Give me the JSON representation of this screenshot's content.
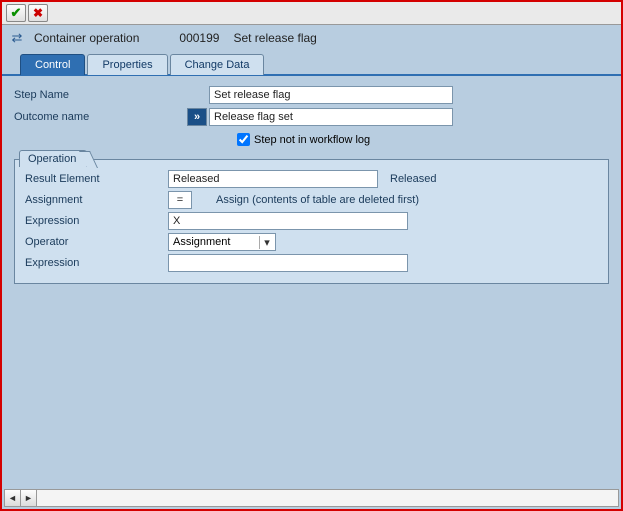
{
  "title": {
    "object": "Container operation",
    "number": "000199",
    "desc": "Set release flag"
  },
  "tabs": [
    {
      "label": "Control",
      "active": true
    },
    {
      "label": "Properties",
      "active": false
    },
    {
      "label": "Change Data",
      "active": false
    }
  ],
  "control": {
    "step_name_label": "Step Name",
    "step_name_value": "Set release flag",
    "outcome_name_label": "Outcome name",
    "outcome_name_value": "Release flag set",
    "not_in_log_label": "Step not in workflow log",
    "not_in_log_checked": true
  },
  "operation": {
    "legend": "Operation",
    "result_label": "Result Element",
    "result_value": "Released",
    "result_after": "Released",
    "assignment_label": "Assignment",
    "assignment_value": "=",
    "assignment_desc": "Assign (contents of table are deleted first)",
    "expression1_label": "Expression",
    "expression1_value": "X",
    "operator_label": "Operator",
    "operator_value": "Assignment",
    "expression2_label": "Expression",
    "expression2_value": ""
  }
}
